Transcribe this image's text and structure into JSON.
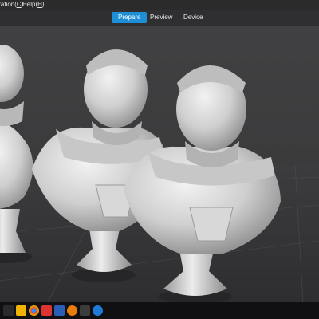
{
  "menubar": {
    "items": [
      {
        "label": "Calibration(",
        "key": "C",
        "suffix": ")"
      },
      {
        "label": "Help(",
        "key": "H",
        "suffix": ")"
      }
    ]
  },
  "toolbar": {
    "tabs": [
      {
        "label": "Prepare",
        "active": true
      },
      {
        "label": "Preview",
        "active": false
      },
      {
        "label": "Device",
        "active": false
      }
    ]
  },
  "viewport": {
    "model_count": 3,
    "accent_color": "#1e8fd6",
    "background_color": "#3a3a3b"
  },
  "taskbar": {
    "icons": [
      "start-icon",
      "file-explorer-icon",
      "chrome-icon",
      "app-icon",
      "save-icon",
      "blender-icon",
      "slicer-icon",
      "edge-icon"
    ]
  }
}
